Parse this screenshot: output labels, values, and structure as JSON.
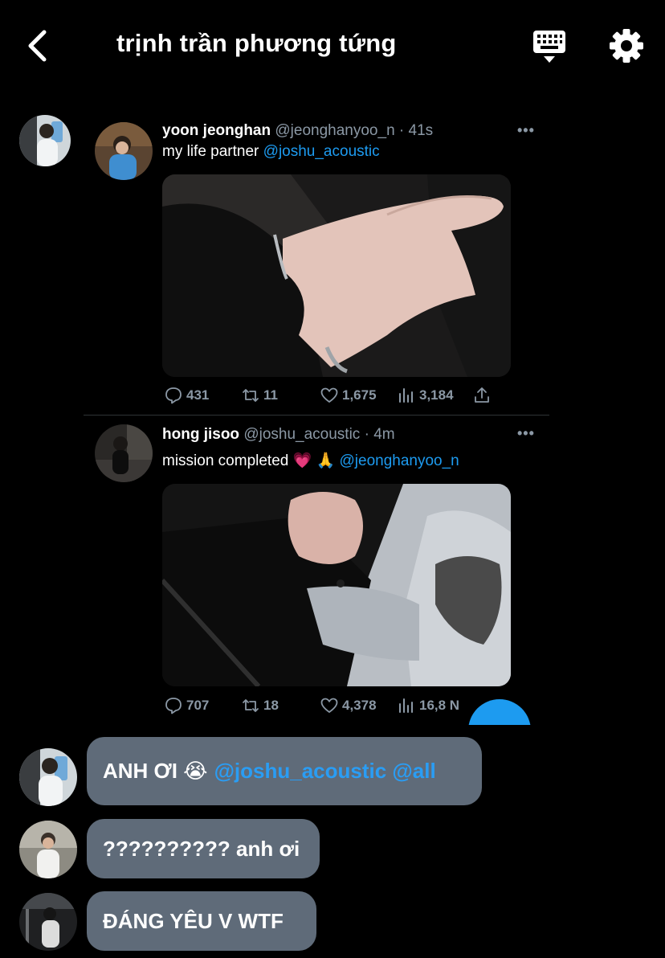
{
  "header": {
    "title": "trịnh trần phương tứng",
    "back_icon": "chevron-left-icon",
    "keyboard_icon": "keyboard-icon",
    "settings_icon": "gear-icon"
  },
  "tweets": [
    {
      "name": "yoon jeonghan",
      "handle": "@jeonghanyoo_n",
      "time": "· 41s",
      "text": "my life partner",
      "mention": "@joshu_acoustic",
      "more": "•••",
      "replies": "431",
      "retweets": "11",
      "likes": "1,675",
      "views": "3,184"
    },
    {
      "name": "hong jisoo",
      "handle": "@joshu_acoustic",
      "time": "· 4m",
      "text": "mission completed",
      "emoji": "💗 🙏",
      "mention": "@jeonghanyoo_n",
      "more": "•••",
      "replies": "707",
      "retweets": "18",
      "likes": "4,378",
      "views": "16,8 N"
    }
  ],
  "messages": [
    {
      "text": "ANH ƠI 😭 ",
      "mentions": "@joshu_acoustic @all"
    },
    {
      "text": "?????????? anh ơi"
    },
    {
      "text": "ĐÁNG YÊU V WTF"
    }
  ],
  "colors": {
    "background": "#000000",
    "accent": "#1d9bf0",
    "bubble": "#5f6b79",
    "muted": "#8b98a5"
  }
}
